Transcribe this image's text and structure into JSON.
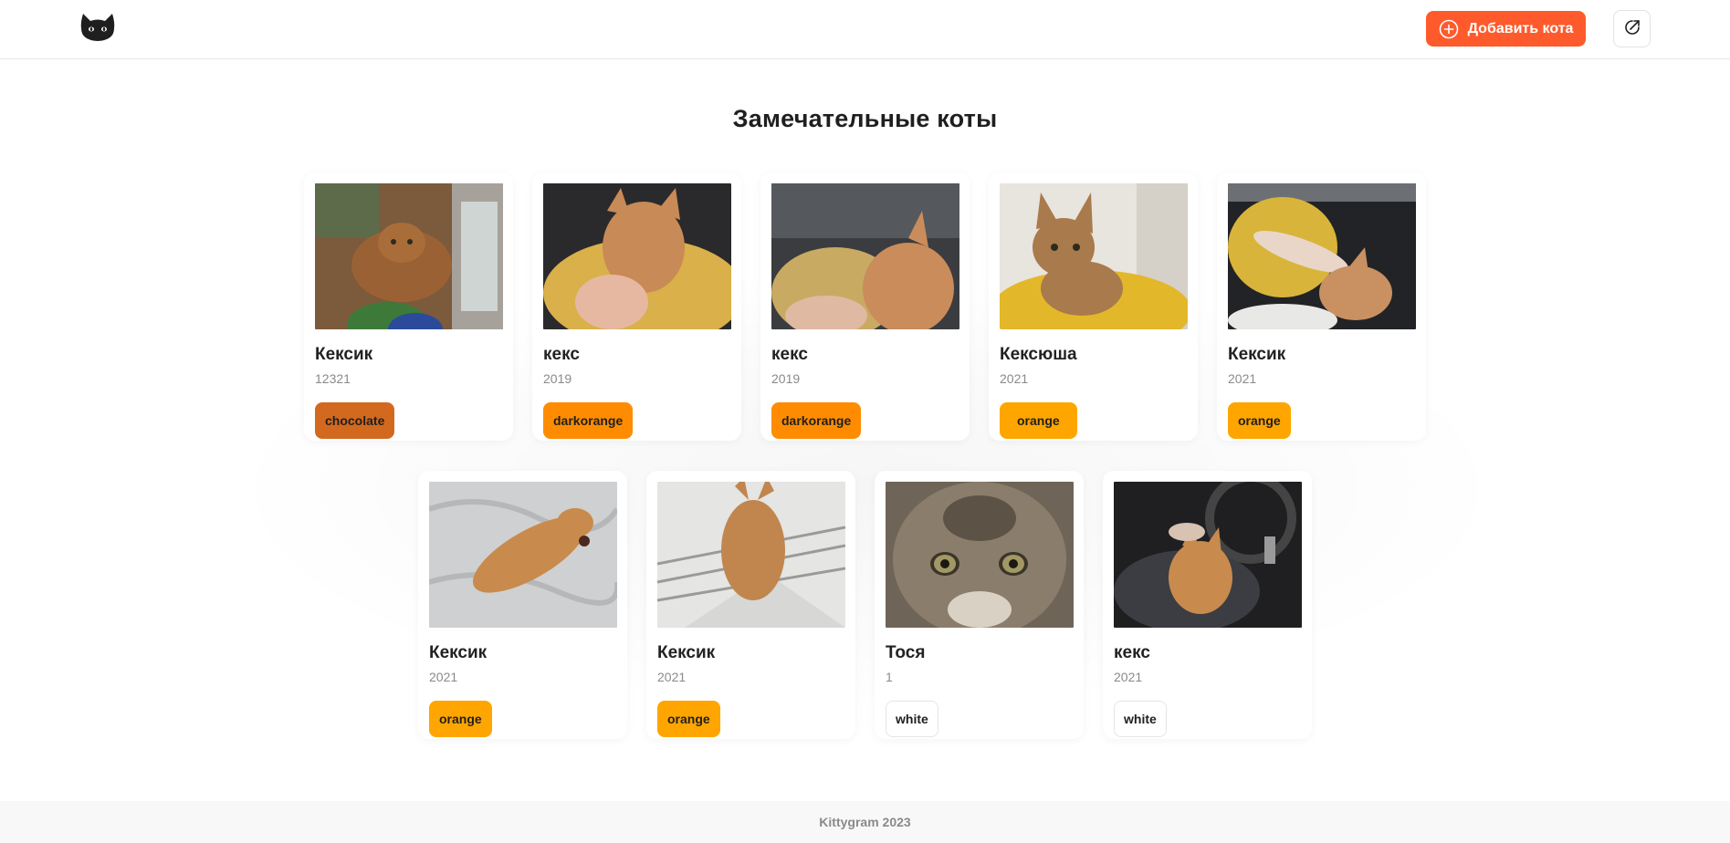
{
  "header": {
    "add_button_label": "Добавить кота",
    "logo_icon": "cat-head-icon",
    "logout_icon": "logout-icon",
    "accent_color": "#ff5a2c"
  },
  "main": {
    "title": "Замечательные коты"
  },
  "cats": [
    {
      "name": "Кексик",
      "year": "12321",
      "color": "chocolate",
      "color_hex": "#d2691e"
    },
    {
      "name": "кекс",
      "year": "2019",
      "color": "darkorange",
      "color_hex": "#ff8c00"
    },
    {
      "name": "кекс",
      "year": "2019",
      "color": "darkorange",
      "color_hex": "#ff8c00"
    },
    {
      "name": "Кексюша",
      "year": "2021",
      "color": "orange",
      "color_hex": "#ffa500"
    },
    {
      "name": "Кексик",
      "year": "2021",
      "color": "orange",
      "color_hex": "#ffa500"
    },
    {
      "name": "Кексик",
      "year": "2021",
      "color": "orange",
      "color_hex": "#ffa500"
    },
    {
      "name": "Кексик",
      "year": "2021",
      "color": "orange",
      "color_hex": "#ffa500"
    },
    {
      "name": "Тося",
      "year": "1",
      "color": "white",
      "color_hex": "#ffffff"
    },
    {
      "name": "кекс",
      "year": "2021",
      "color": "white",
      "color_hex": "#ffffff"
    }
  ],
  "footer": {
    "text": "Kittygram 2023"
  }
}
